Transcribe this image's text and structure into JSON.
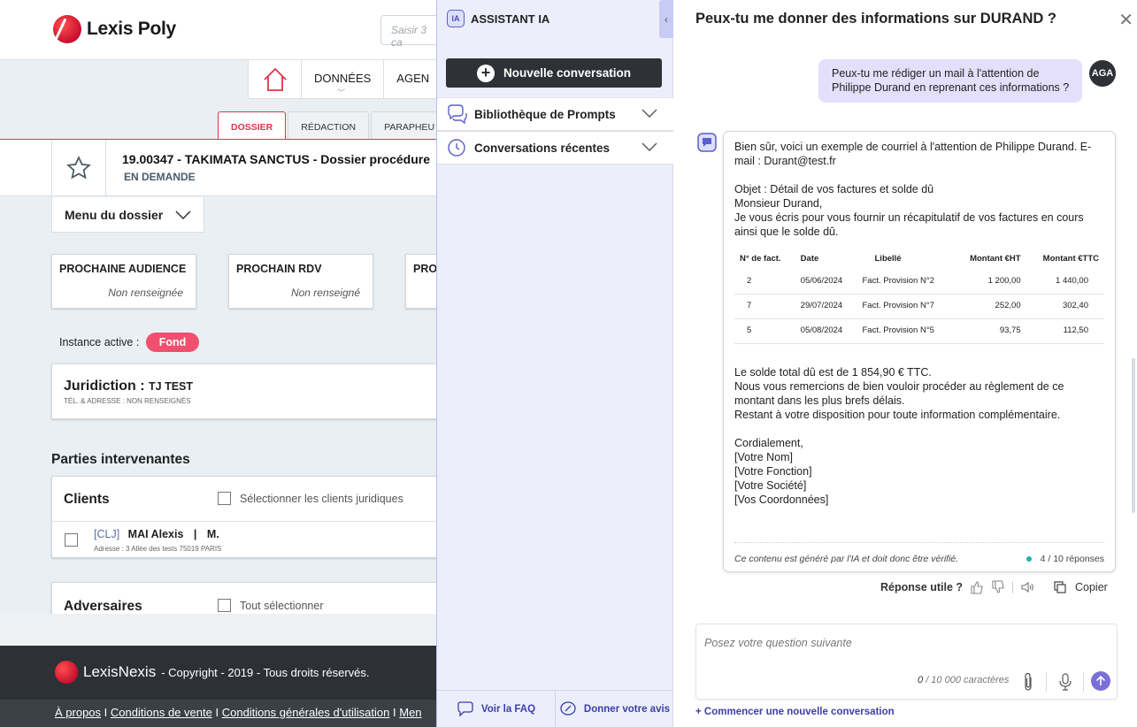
{
  "app": {
    "logo_text": "Lexis Poly",
    "search_placeholder": "Saisir 3 ca",
    "nav": [
      "DONNÉES",
      "AGEN"
    ],
    "tabs": [
      "DOSSIER",
      "RÉDACTION",
      "PARAPHEU"
    ],
    "dossier_title": "19.00347 - TAKIMATA SANCTUS - Dossier procédure",
    "dossier_status": "EN DEMANDE",
    "menu_dossier": "Menu du dossier",
    "cards": [
      {
        "title": "PROCHAINE AUDIENCE",
        "value": "Non renseignée"
      },
      {
        "title": "PROCHAIN RDV",
        "value": "Non renseigné"
      },
      {
        "title": "PRO",
        "value": ""
      }
    ],
    "instance_label": "Instance active :",
    "instance_value": "Fond",
    "juridiction_label": "Juridiction :",
    "juridiction_value": "TJ TEST",
    "juridiction_sub": "TÉL. & ADRESSE : NON RENSEIGNÉS",
    "parties_heading": "Parties intervenantes",
    "clients_label": "Clients",
    "clients_select": "Sélectionner les clients juridiques",
    "client_tag": "[CLJ]",
    "client_name": "MAI Alexis",
    "client_sep": "|",
    "client_title": "M.",
    "client_address": "Adresse : 3 Allée des tests 75019 PARIS",
    "adversaires_label": "Adversaires",
    "adversaires_select": "Tout sélectionner",
    "footer_brand": "LexisNexis",
    "footer_text": "- Copyright - 2019 - Tous droits réservés.",
    "footer_links": [
      "À propos",
      "I",
      "Conditions de vente",
      "I",
      "Conditions générales d'utilisation",
      "I",
      "Men"
    ]
  },
  "assistant": {
    "title": "ASSISTANT IA",
    "badge": "IA",
    "new_conversation": "Nouvelle conversation",
    "prompts_library": "Bibliothèque de Prompts",
    "recent_conversations": "Conversations récentes",
    "faq": "Voir la FAQ",
    "feedback": "Donner votre avis"
  },
  "chat": {
    "title": "Peux-tu me donner des informations sur DURAND ?",
    "user_message": "Peux-tu me rédiger un mail à l'attention de Philippe Durand en reprenant ces informations ?",
    "user_initials": "AGA",
    "response_intro": "Bien sûr, voici un exemple de courriel à l'attention de Philippe Durand. E-mail : Durant@test.fr",
    "response_body": "Objet : Détail de vos factures et solde dû\nMonsieur Durand,\nJe vous écris pour vous fournir un récapitulatif de vos factures en cours ainsi que le solde dû.",
    "table": {
      "headers": [
        "N° de fact.",
        "Date",
        "Libellé",
        "Montant €HT",
        "Montant €TTC"
      ],
      "rows": [
        [
          "2",
          "05/06/2024",
          "Fact. Provision N°2",
          "1 200,00",
          "1 440,00"
        ],
        [
          "7",
          "29/07/2024",
          "Fact. Provision N°7",
          "252,00",
          "302,40"
        ],
        [
          "5",
          "05/08/2024",
          "Fact. Provision N°5",
          "93,75",
          "112,50"
        ]
      ]
    },
    "response_closing": "Le solde total dû est de 1 854,90 € TTC.\nNous vous remercions de bien vouloir procéder au règlement de ce montant dans les plus brefs délais.\nRestant à votre disposition pour toute information complémentaire.",
    "response_signature": "Cordialement,\n[Votre Nom]\n [Votre Fonction]\n [Votre Société]\n [Vos Coordonnées]",
    "disclaimer": "Ce contenu est généré par l'IA et doit donc être vérifié.",
    "response_count": "4 / 10 réponses",
    "useful_label": "Réponse utile ?",
    "copy_label": "Copier",
    "input_placeholder": "Posez votre question suivante",
    "char_count": "0",
    "char_limit": "/ 10 000 caractères",
    "new_conversation_link": "+ Commencer une nouvelle conversation"
  },
  "colors": {
    "accent_red": "#e0334d",
    "assistant_purple": "#5b5fc7",
    "user_bubble": "#e4dffa",
    "dark_button": "#2e3135"
  }
}
